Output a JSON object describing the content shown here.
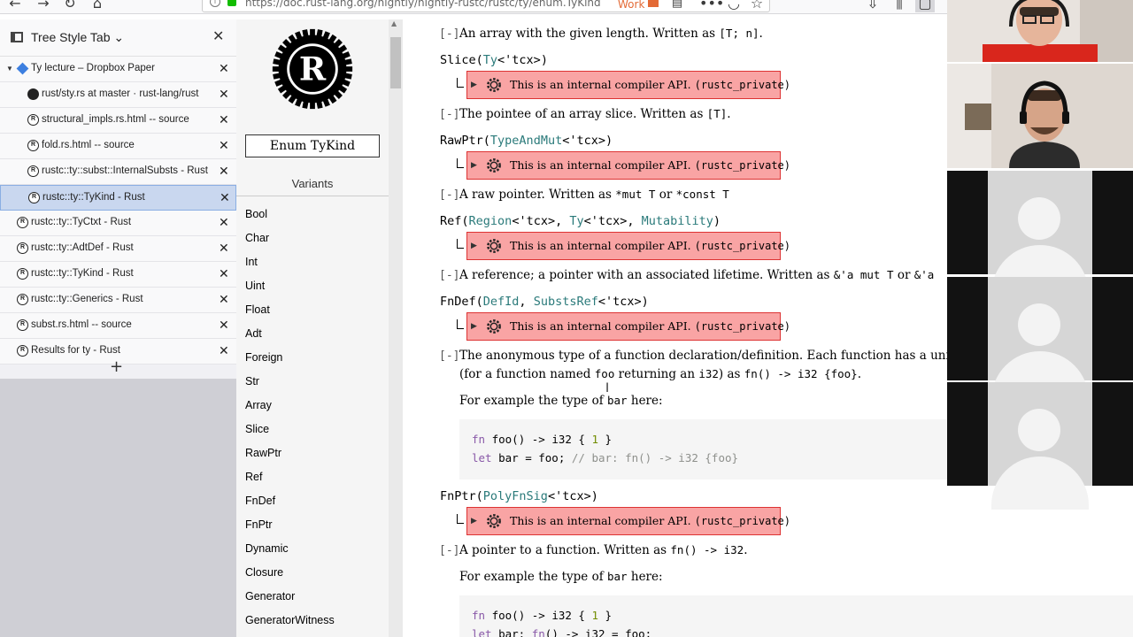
{
  "browser": {
    "url": "https://doc.rust-lang.org/nightly/nightly-rustc/rustc/ty/enum.TyKind",
    "container_label": "Work"
  },
  "tst": {
    "title": "Tree Style Tab",
    "tabs": [
      {
        "label": "Ty lecture – Dropbox Paper",
        "icon": "dropbox-icon",
        "active": false,
        "child": false,
        "twisty": true
      },
      {
        "label": "rust/sty.rs at master · rust-lang/rust",
        "icon": "github-icon",
        "active": false,
        "child": true
      },
      {
        "label": "structural_impls.rs.html -- source",
        "icon": "rust-icon",
        "active": false,
        "child": true
      },
      {
        "label": "fold.rs.html -- source",
        "icon": "rust-icon",
        "active": false,
        "child": true
      },
      {
        "label": "rustc::ty::subst::InternalSubsts - Rust",
        "icon": "rust-icon",
        "active": false,
        "child": true
      },
      {
        "label": "rustc::ty::TyKind - Rust",
        "icon": "rust-icon",
        "active": true,
        "child": true
      },
      {
        "label": "rustc::ty::TyCtxt - Rust",
        "icon": "rust-icon",
        "active": false,
        "child": false
      },
      {
        "label": "rustc::ty::AdtDef - Rust",
        "icon": "rust-icon",
        "active": false,
        "child": false
      },
      {
        "label": "rustc::ty::TyKind - Rust",
        "icon": "rust-icon",
        "active": false,
        "child": false
      },
      {
        "label": "rustc::ty::Generics - Rust",
        "icon": "rust-icon",
        "active": false,
        "child": false
      },
      {
        "label": "subst.rs.html -- source",
        "icon": "rust-icon",
        "active": false,
        "child": false
      },
      {
        "label": "Results for ty - Rust",
        "icon": "rust-icon",
        "active": false,
        "child": false
      }
    ]
  },
  "docside": {
    "enum_name": "Enum TyKind",
    "variants_title": "Variants",
    "variants": [
      "Bool",
      "Char",
      "Int",
      "Uint",
      "Float",
      "Adt",
      "Foreign",
      "Str",
      "Array",
      "Slice",
      "RawPtr",
      "Ref",
      "FnDef",
      "FnPtr",
      "Dynamic",
      "Closure",
      "Generator",
      "GeneratorWitness"
    ]
  },
  "main": {
    "toggle": "[-]",
    "unstable_text": "This is an internal compiler API.",
    "unstable_feature": "(rustc_private)",
    "array_desc_pre": "An array with the given length. Written as",
    "array_desc_code": "[T; n]",
    "slice_sig_name": "Slice",
    "slice_sig_ty": "Ty",
    "slice_sig_rest": "<'tcx>)",
    "slice_desc_pre": "The pointee of an array slice. Written as",
    "slice_desc_code": "[T]",
    "rawptr_sig_name": "RawPtr",
    "rawptr_sig_ty": "TypeAndMut",
    "rawptr_sig_rest": "<'tcx>)",
    "rawptr_desc_pre": "A raw pointer. Written as",
    "rawptr_desc_code1": "*mut T",
    "rawptr_desc_or": "or",
    "rawptr_desc_code2": "*const T",
    "ref_sig_name": "Ref",
    "ref_sig_t1": "Region",
    "ref_sig_m1": "<'tcx>, ",
    "ref_sig_t2": "Ty",
    "ref_sig_m2": "<'tcx>, ",
    "ref_sig_t3": "Mutability",
    "ref_desc_pre": "A reference; a pointer with an associated lifetime. Written as",
    "ref_desc_code1": "&'a mut T",
    "ref_desc_or": "or",
    "ref_desc_code2": "&'a",
    "fndef_sig_name": "FnDef",
    "fndef_sig_t1": "DefId",
    "fndef_sig_m1": ", ",
    "fndef_sig_t2": "SubstsRef",
    "fndef_sig_rest": "<'tcx>)",
    "fndef_desc1": "The anonymous type of a function declaration/definition. Each function has a uniq",
    "fndef_desc2_pre": "(for a function named",
    "fndef_desc2_c1": "foo",
    "fndef_desc2_mid": "returning an",
    "fndef_desc2_c2": "i32",
    "fndef_desc2_as": ") as",
    "fndef_desc2_c3": "fn() -> i32 {foo}",
    "fndef_desc2_end": ".",
    "example_pre": "For example the type of",
    "example_code": "bar",
    "example_post": "here:",
    "code1_line1_kw": "fn",
    "code1_line1_rest": " foo() -> i32 { ",
    "code1_line1_num": "1",
    "code1_line1_end": " }",
    "code1_line2_kw": "let",
    "code1_line2_rest": " bar = foo; ",
    "code1_line2_cm": "// bar: fn() -> i32 {foo}",
    "fnptr_sig_name": "FnPtr",
    "fnptr_sig_ty": "PolyFnSig",
    "fnptr_sig_rest": "<'tcx>)",
    "fnptr_desc_pre": "A pointer to a function. Written as",
    "fnptr_desc_code": "fn() -> i32",
    "fnptr_desc_end": ".",
    "code2_line2_kw": "let",
    "code2_line2_rest": " bar: ",
    "code2_line2_kw2": "fn",
    "code2_line2_rest2": "() -> i32 = foo;"
  },
  "colors": {
    "unstable_bg": "#f9a4a4",
    "unstable_border": "#dd3333",
    "active_tab": "#c9d7ef",
    "type_link": "#2a7a7a"
  }
}
